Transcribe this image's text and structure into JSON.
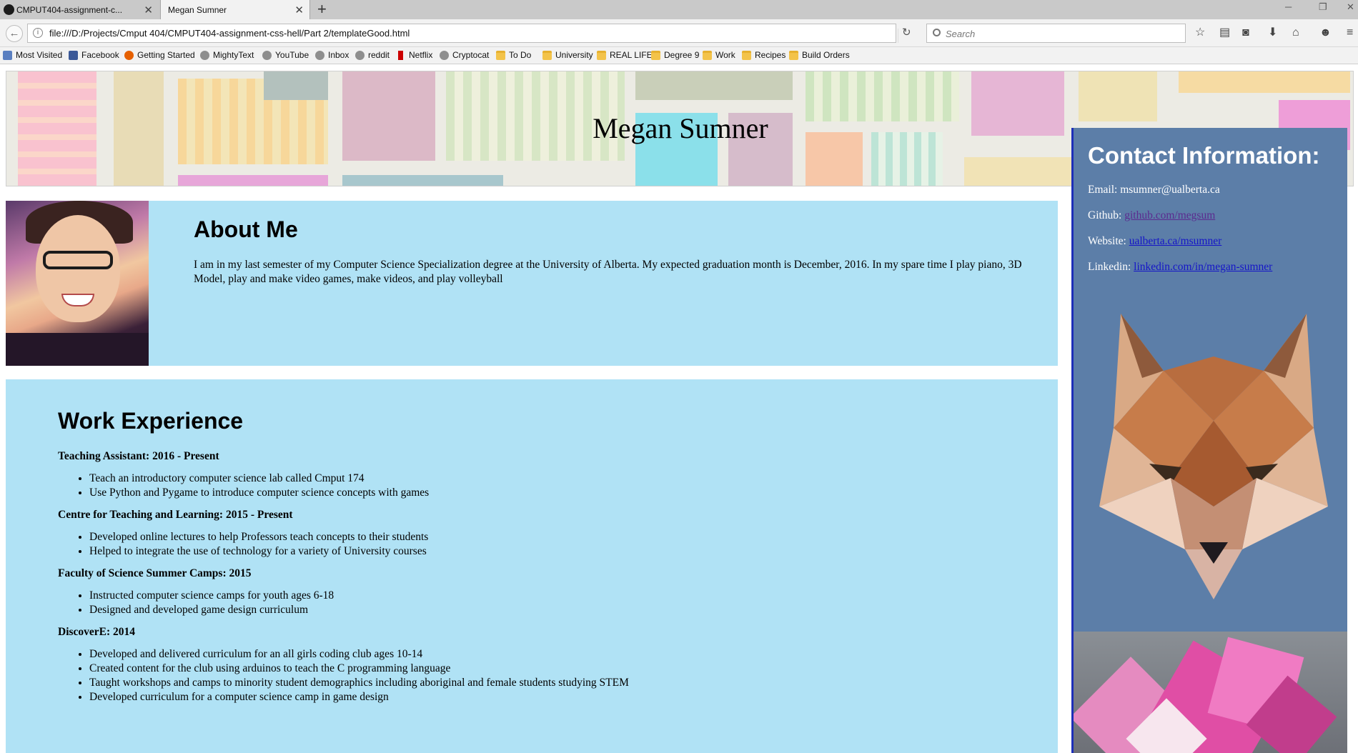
{
  "browser": {
    "tabs": [
      {
        "title": "CMPUT404-assignment-c...",
        "active": false
      },
      {
        "title": "Megan Sumner",
        "active": true
      }
    ],
    "url": "file:///D:/Projects/Cmput 404/CMPUT404-assignment-css-hell/Part 2/templateGood.html",
    "search_placeholder": "Search",
    "bookmarks": [
      {
        "label": "Most Visited",
        "icon": "most-visited-icon"
      },
      {
        "label": "Facebook",
        "icon": "facebook-icon"
      },
      {
        "label": "Getting Started",
        "icon": "firefox-icon"
      },
      {
        "label": "MightyText",
        "icon": "globe-icon"
      },
      {
        "label": "YouTube",
        "icon": "globe-icon"
      },
      {
        "label": "Inbox",
        "icon": "globe-icon"
      },
      {
        "label": "reddit",
        "icon": "globe-icon"
      },
      {
        "label": "Netflix",
        "icon": "netflix-icon"
      },
      {
        "label": "Cryptocat",
        "icon": "globe-icon"
      },
      {
        "label": "To Do",
        "icon": "folder-icon"
      },
      {
        "label": "University",
        "icon": "folder-icon"
      },
      {
        "label": "REAL LIFE",
        "icon": "folder-icon"
      },
      {
        "label": "Degree 9",
        "icon": "folder-icon"
      },
      {
        "label": "Work",
        "icon": "folder-icon"
      },
      {
        "label": "Recipes",
        "icon": "folder-icon"
      },
      {
        "label": "Build Orders",
        "icon": "folder-icon"
      }
    ]
  },
  "page": {
    "banner_title": "Megan Sumner",
    "about": {
      "heading": "About Me",
      "text": "I am in my last semester of my Computer Science Specialization degree at the University of Alberta. My expected graduation month is December, 2016. In my spare time I play piano, 3D Model, play and make video games, make videos, and play volleyball"
    },
    "work": {
      "heading": "Work Experience",
      "jobs": [
        {
          "title": "Teaching Assistant: 2016 - Present",
          "items": [
            "Teach an introductory computer science lab called Cmput 174",
            "Use Python and Pygame to introduce computer science concepts with games"
          ]
        },
        {
          "title": "Centre for Teaching and Learning: 2015 - Present",
          "items": [
            "Developed online lectures to help Professors teach concepts to their students",
            "Helped to integrate the use of technology for a variety of University courses"
          ]
        },
        {
          "title": "Faculty of Science Summer Camps: 2015",
          "items": [
            "Instructed computer science camps for youth ages 6-18",
            "Designed and developed game design curriculum"
          ]
        },
        {
          "title": "DiscoverE: 2014",
          "items": [
            "Developed and delivered curriculum for an all girls coding club ages 10-14",
            "Created content for the club using arduinos to teach the C programming language",
            "Taught workshops and camps to minority student demographics including aboriginal and female students studying STEM",
            "Developed curriculum for a computer science camp in game design"
          ]
        }
      ]
    },
    "contact": {
      "heading": "Contact Information:",
      "email_label": "Email:",
      "email": "msumner@ualberta.ca",
      "github_label": "Github:",
      "github_link": "github.com/megsum",
      "website_label": "Website:",
      "website_link": "ualberta.ca/msumner",
      "linkedin_label": "Linkedin:",
      "linkedin_link": "linkedin.com/in/megan-sumner"
    }
  },
  "colors": {
    "section_bg": "#b0e2f5",
    "sidebar_bg": "#5c7ea8",
    "sidebar_border": "#1e2fb8",
    "link": "#1515c8",
    "visited_link": "#5b2b8f"
  }
}
